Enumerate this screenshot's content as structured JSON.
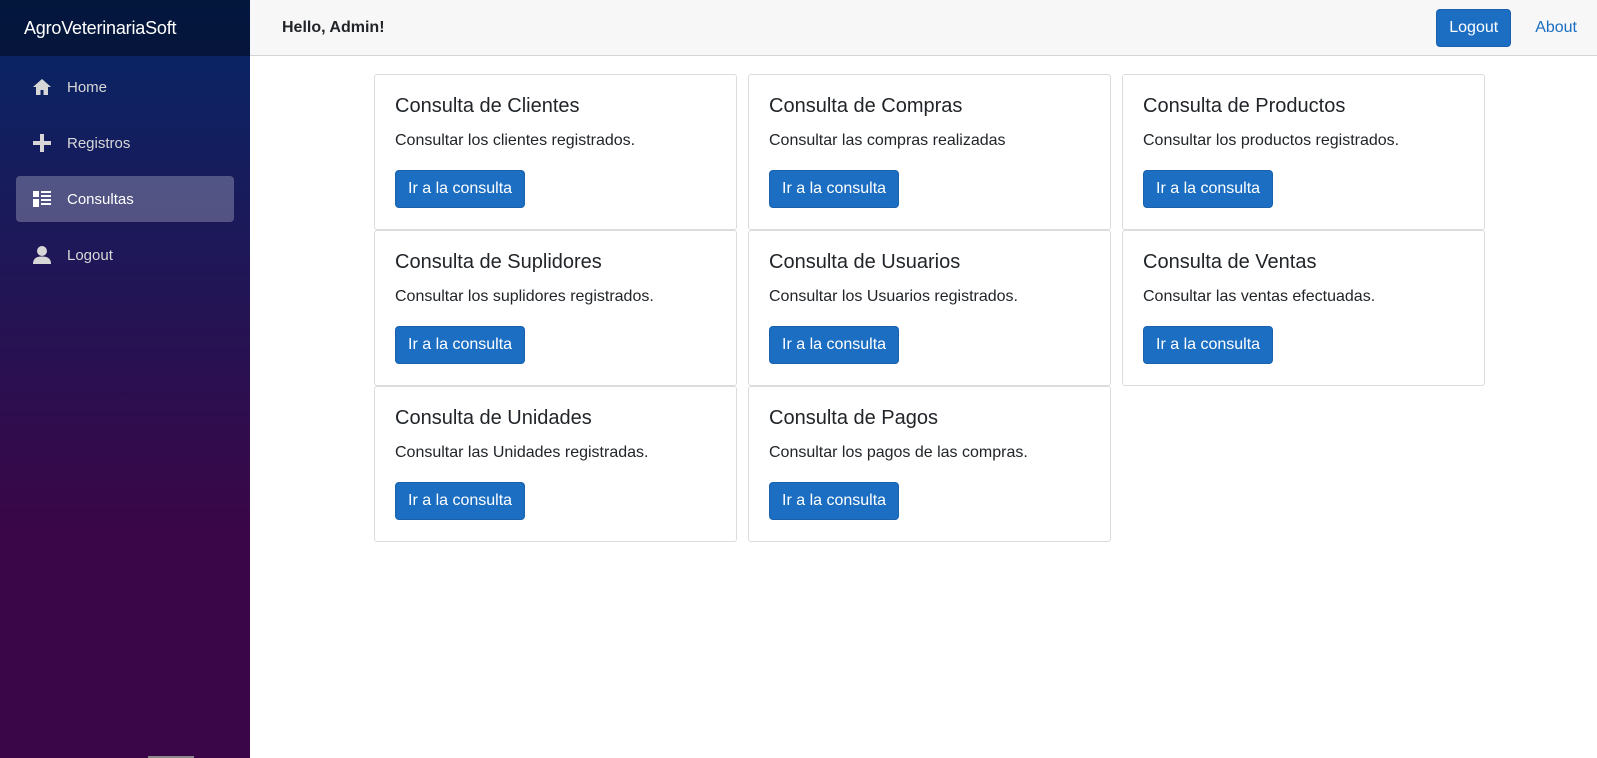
{
  "app": {
    "brand": "AgroVeterinariaSoft"
  },
  "sidebar": {
    "items": [
      {
        "label": "Home",
        "icon": "home-icon",
        "active": false
      },
      {
        "label": "Registros",
        "icon": "plus-icon",
        "active": false
      },
      {
        "label": "Consultas",
        "icon": "list-icon",
        "active": true
      },
      {
        "label": "Logout",
        "icon": "person-icon",
        "active": false
      }
    ]
  },
  "header": {
    "greeting": "Hello, Admin!",
    "logout_label": "Logout",
    "about_label": "About"
  },
  "cards": [
    {
      "title": "Consulta de Clientes",
      "text": "Consultar los clientes registrados.",
      "button": "Ir a la consulta"
    },
    {
      "title": "Consulta de Compras",
      "text": "Consultar las compras realizadas",
      "button": "Ir a la consulta"
    },
    {
      "title": "Consulta de Productos",
      "text": "Consultar los productos registrados.",
      "button": "Ir a la consulta"
    },
    {
      "title": "Consulta de Suplidores",
      "text": "Consultar los suplidores registrados.",
      "button": "Ir a la consulta"
    },
    {
      "title": "Consulta de Usuarios",
      "text": "Consultar los Usuarios registrados.",
      "button": "Ir a la consulta"
    },
    {
      "title": "Consulta de Ventas",
      "text": "Consultar las ventas efectuadas.",
      "button": "Ir a la consulta"
    },
    {
      "title": "Consulta de Unidades",
      "text": "Consultar las Unidades registradas.",
      "button": "Ir a la consulta"
    },
    {
      "title": "Consulta de Pagos",
      "text": "Consultar los pagos de las compras.",
      "button": "Ir a la consulta"
    }
  ],
  "colors": {
    "primary": "#1b6ec2",
    "sidebar_top": "#052767",
    "sidebar_bottom": "#3a0647"
  }
}
